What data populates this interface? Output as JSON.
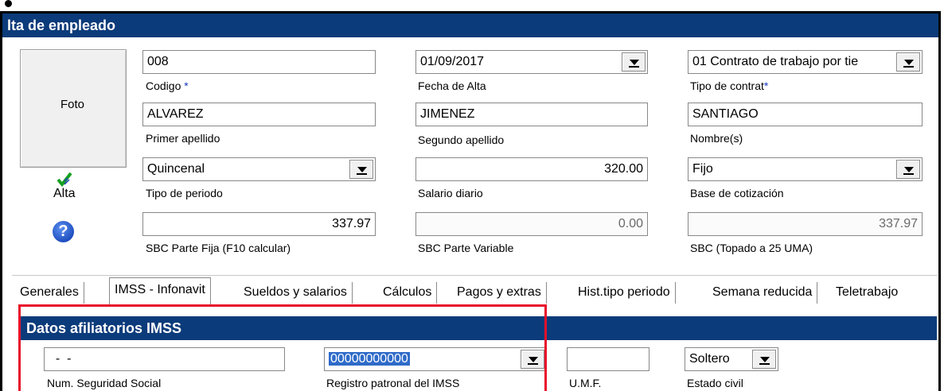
{
  "window": {
    "title": "lta de empleado"
  },
  "photo": {
    "label": "Foto"
  },
  "status": {
    "alta_label": "Alta"
  },
  "fields": {
    "codigo": {
      "value": "008",
      "label": "Codigo",
      "required": "*"
    },
    "fecha_alta": {
      "value": "01/09/2017",
      "label": "Fecha de Alta"
    },
    "tipo_contrato": {
      "value": "01 Contrato de trabajo por tie",
      "label": "Tipo de contrat",
      "required": "*"
    },
    "primer_apellido": {
      "value": "ALVAREZ",
      "label": "Primer apellido"
    },
    "segundo_apellido": {
      "value": "JIMENEZ",
      "label": "Segundo apellido"
    },
    "nombre": {
      "value": "SANTIAGO",
      "label": "Nombre(s)"
    },
    "tipo_periodo": {
      "value": "Quincenal",
      "label": "Tipo de periodo"
    },
    "salario_diario": {
      "value": "320.00",
      "label": "Salario diario"
    },
    "base_cotizacion": {
      "value": "Fijo",
      "label": "Base de cotización"
    },
    "sbc_fija": {
      "value": "337.97",
      "label": "SBC Parte Fija  (F10 calcular)"
    },
    "sbc_variable": {
      "value": "0.00",
      "label": "SBC Parte Variable"
    },
    "sbc_topado": {
      "value": "337.97",
      "label": "SBC (Topado a 25 UMA)"
    }
  },
  "tabs": [
    {
      "label": "Generales"
    },
    {
      "label": "IMSS - Infonavit"
    },
    {
      "label": "Sueldos y salarios"
    },
    {
      "label": "Cálculos"
    },
    {
      "label": "Pagos y extras"
    },
    {
      "label": "Hist.tipo periodo"
    },
    {
      "label": "Semana reducida"
    },
    {
      "label": "Teletrabajo"
    }
  ],
  "active_tab": "IMSS - Infonavit",
  "imss": {
    "section_title": "Datos afiliatorios IMSS",
    "nss": {
      "value": "  -  -  ",
      "label": "Num. Seguridad Social"
    },
    "registro_patronal": {
      "value": "00000000000",
      "label": "Registro patronal del IMSS"
    },
    "umf": {
      "value": "",
      "label": "U.M.F."
    },
    "estado_civil": {
      "value": "Soltero",
      "label": "Estado civil"
    }
  },
  "colors": {
    "titlebar": "#0b3b7a",
    "highlight": "#e8102a"
  }
}
